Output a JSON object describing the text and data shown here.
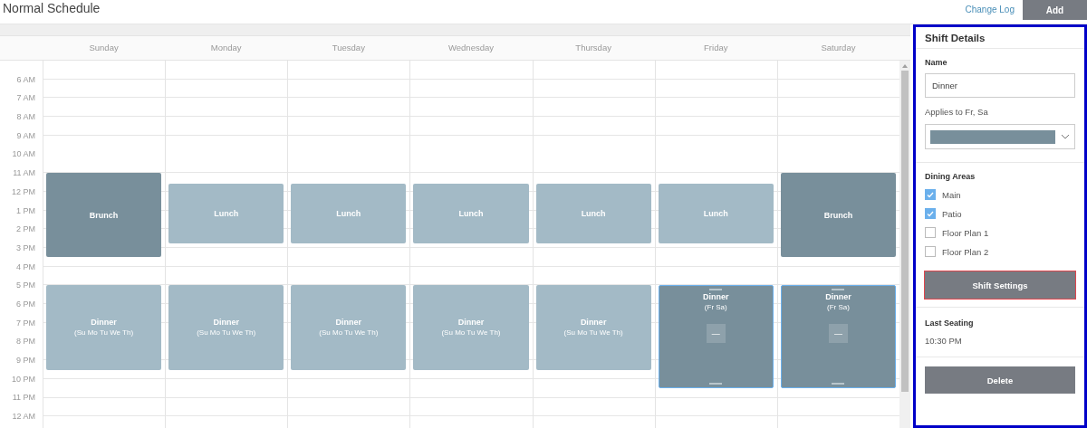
{
  "page": {
    "title": "Normal Schedule",
    "change_log": "Change Log",
    "add_button": "Add"
  },
  "days": [
    {
      "name": "Sunday",
      "shifts": [
        {
          "kind": "brunch",
          "name": "Brunch",
          "selected": false
        },
        {
          "kind": "dinner",
          "name": "Dinner",
          "days": "(Su Mo Tu We Th)",
          "selected": false
        }
      ]
    },
    {
      "name": "Monday",
      "shifts": [
        {
          "kind": "lunch",
          "name": "Lunch",
          "selected": false
        },
        {
          "kind": "dinner",
          "name": "Dinner",
          "days": "(Su Mo Tu We Th)",
          "selected": false
        }
      ]
    },
    {
      "name": "Tuesday",
      "shifts": [
        {
          "kind": "lunch",
          "name": "Lunch",
          "selected": false
        },
        {
          "kind": "dinner",
          "name": "Dinner",
          "days": "(Su Mo Tu We Th)",
          "selected": false
        }
      ]
    },
    {
      "name": "Wednesday",
      "shifts": [
        {
          "kind": "lunch",
          "name": "Lunch",
          "selected": false
        },
        {
          "kind": "dinner",
          "name": "Dinner",
          "days": "(Su Mo Tu We Th)",
          "selected": false
        }
      ]
    },
    {
      "name": "Thursday",
      "shifts": [
        {
          "kind": "lunch",
          "name": "Lunch",
          "selected": false
        },
        {
          "kind": "dinner",
          "name": "Dinner",
          "days": "(Su Mo Tu We Th)",
          "selected": false
        }
      ]
    },
    {
      "name": "Friday",
      "shifts": [
        {
          "kind": "lunch",
          "name": "Lunch",
          "selected": false
        },
        {
          "kind": "late-dinner",
          "name": "Dinner",
          "days": "(Fr Sa)",
          "selected": true,
          "minus": "—"
        }
      ]
    },
    {
      "name": "Saturday",
      "shifts": [
        {
          "kind": "brunch",
          "name": "Brunch",
          "selected": false
        },
        {
          "kind": "late-dinner",
          "name": "Dinner",
          "days": "(Fr Sa)",
          "selected": true,
          "minus": "—"
        }
      ]
    }
  ],
  "hours": [
    "6 AM",
    "7 AM",
    "8 AM",
    "9 AM",
    "10 AM",
    "11 AM",
    "12 PM",
    "1 PM",
    "2 PM",
    "3 PM",
    "4 PM",
    "5 PM",
    "6 PM",
    "7 PM",
    "8 PM",
    "9 PM",
    "10 PM",
    "11 PM",
    "12 AM"
  ],
  "details": {
    "title": "Shift Details",
    "name_label": "Name",
    "name_value": "Dinner",
    "applies_to": "Applies to Fr, Sa",
    "color": "#788f9b",
    "dining_areas_label": "Dining Areas",
    "dining_areas": [
      {
        "label": "Main",
        "checked": true
      },
      {
        "label": "Patio",
        "checked": true
      },
      {
        "label": "Floor Plan 1",
        "checked": false
      },
      {
        "label": "Floor Plan 2",
        "checked": false
      }
    ],
    "settings_button": "Shift Settings",
    "last_seating_label": "Last Seating",
    "last_seating": "10:30 PM",
    "delete_button": "Delete"
  }
}
